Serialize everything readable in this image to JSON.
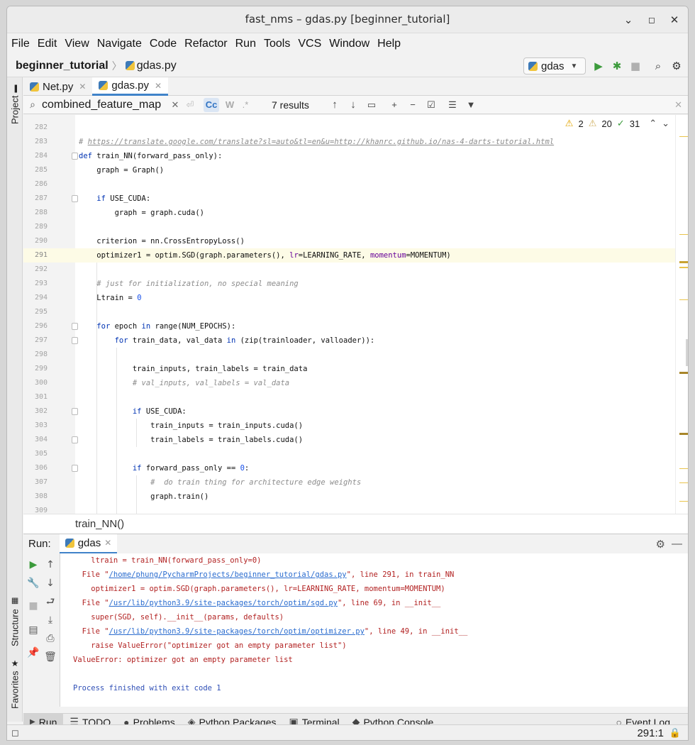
{
  "window": {
    "title": "fast_nms – gdas.py [beginner_tutorial]"
  },
  "menu": [
    "File",
    "Edit",
    "View",
    "Navigate",
    "Code",
    "Refactor",
    "Run",
    "Tools",
    "VCS",
    "Window",
    "Help"
  ],
  "nav": {
    "project": "beginner_tutorial",
    "file": "gdas.py",
    "run_config": "gdas"
  },
  "side_tabs": {
    "project": "Project",
    "structure": "Structure",
    "favorites": "Favorites"
  },
  "tabs": [
    {
      "label": "Net.py",
      "active": false
    },
    {
      "label": "gdas.py",
      "active": true
    }
  ],
  "search": {
    "query": "combined_feature_map",
    "results": "7 results",
    "cc": "Cc",
    "w": "W",
    "regex": ".*"
  },
  "inspections": {
    "warnings": "2",
    "weak_warnings": "20",
    "typos": "31"
  },
  "editor_lines": [
    {
      "num": "282",
      "code": ""
    },
    {
      "num": "283",
      "code": "# https://translate.google.com/translate?sl=auto&tl=en&u=http://khanrc.github.io/nas-4-darts-tutorial.html"
    },
    {
      "num": "284",
      "code": "def train_NN(forward_pass_only):"
    },
    {
      "num": "285",
      "code": "    graph = Graph()"
    },
    {
      "num": "286",
      "code": ""
    },
    {
      "num": "287",
      "code": "    if USE_CUDA:"
    },
    {
      "num": "288",
      "code": "        graph = graph.cuda()"
    },
    {
      "num": "289",
      "code": ""
    },
    {
      "num": "290",
      "code": "    criterion = nn.CrossEntropyLoss()"
    },
    {
      "num": "291",
      "code": "    optimizer1 = optim.SGD(graph.parameters(), lr=LEARNING_RATE, momentum=MOMENTUM)"
    },
    {
      "num": "292",
      "code": ""
    },
    {
      "num": "293",
      "code": "    # just for initialization, no special meaning"
    },
    {
      "num": "294",
      "code": "    Ltrain = 0"
    },
    {
      "num": "295",
      "code": ""
    },
    {
      "num": "296",
      "code": "    for epoch in range(NUM_EPOCHS):"
    },
    {
      "num": "297",
      "code": "        for train_data, val_data in (zip(trainloader, valloader)):"
    },
    {
      "num": "298",
      "code": ""
    },
    {
      "num": "299",
      "code": "            train_inputs, train_labels = train_data"
    },
    {
      "num": "300",
      "code": "            # val_inputs, val_labels = val_data"
    },
    {
      "num": "301",
      "code": ""
    },
    {
      "num": "302",
      "code": "            if USE_CUDA:"
    },
    {
      "num": "303",
      "code": "                train_inputs = train_inputs.cuda()"
    },
    {
      "num": "304",
      "code": "                train_labels = train_labels.cuda()"
    },
    {
      "num": "305",
      "code": ""
    },
    {
      "num": "306",
      "code": "            if forward_pass_only == 0:"
    },
    {
      "num": "307",
      "code": "                #  do train thing for architecture edge weights"
    },
    {
      "num": "308",
      "code": "                graph.train()"
    },
    {
      "num": "309",
      "code": ""
    }
  ],
  "code_breadcrumb": "train_NN()",
  "run": {
    "label": "Run:",
    "tab": "gdas",
    "console": [
      {
        "pre": "    ltrain = train_NN(forward_pass_only=0)",
        "link": "",
        "post": ""
      },
      {
        "pre": "  File \"",
        "link": "/home/phung/PycharmProjects/beginner_tutorial/gdas.py",
        "post": "\", line 291, in train_NN"
      },
      {
        "pre": "    optimizer1 = optim.SGD(graph.parameters(), lr=LEARNING_RATE, momentum=MOMENTUM)",
        "link": "",
        "post": ""
      },
      {
        "pre": "  File \"",
        "link": "/usr/lib/python3.9/site-packages/torch/optim/sgd.py",
        "post": "\", line 69, in __init__"
      },
      {
        "pre": "    super(SGD, self).__init__(params, defaults)",
        "link": "",
        "post": ""
      },
      {
        "pre": "  File \"",
        "link": "/usr/lib/python3.9/site-packages/torch/optim/optimizer.py",
        "post": "\", line 49, in __init__"
      },
      {
        "pre": "    raise ValueError(\"optimizer got an empty parameter list\")",
        "link": "",
        "post": ""
      },
      {
        "pre": "ValueError: optimizer got an empty parameter list",
        "link": "",
        "post": ""
      },
      {
        "pre": "",
        "link": "",
        "post": ""
      },
      {
        "pre": "Process finished with exit code 1",
        "link": "",
        "post": "",
        "blue": true
      }
    ]
  },
  "bottom_tabs": [
    "Run",
    "TODO",
    "Problems",
    "Python Packages",
    "Terminal",
    "Python Console"
  ],
  "event_log": "Event Log",
  "status": {
    "position": "291:1"
  },
  "colors": {
    "accent": "#4083c9",
    "run_green": "#3c9b3c",
    "error_red": "#b22222",
    "warning_yellow": "#e9c44c"
  }
}
